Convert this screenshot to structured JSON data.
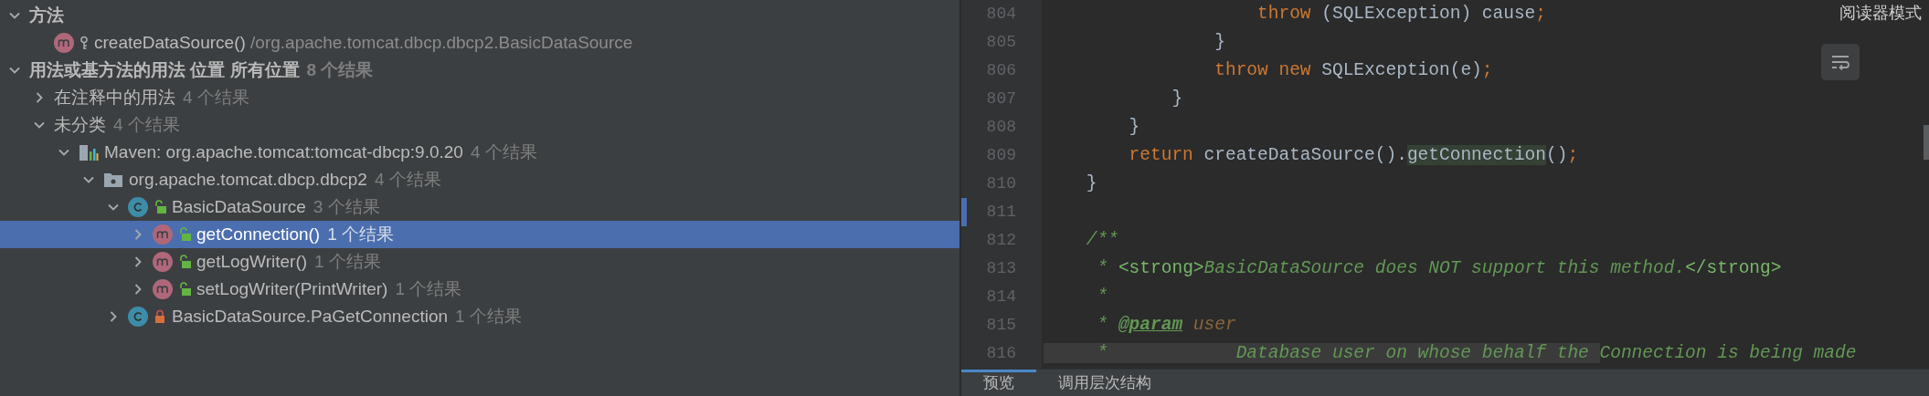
{
  "results_tree": [
    {
      "kind": "group",
      "label": "方法",
      "expanded": true,
      "selected": false,
      "children": [
        {
          "kind": "method",
          "access": {
            "kind": "key"
          },
          "label": "createDataSource()",
          "path": "/org.apache.tomcat.dbcp.dbcp2.BasicDataSource",
          "selected": false
        }
      ]
    },
    {
      "kind": "group",
      "label": "用法或基方法的用法 位置 所有位置",
      "count": "8 个结果",
      "expanded": true,
      "selected": false,
      "children": [
        {
          "kind": "category",
          "label": "在注释中的用法",
          "count": "4 个结果",
          "expanded": false,
          "selected": false
        },
        {
          "kind": "category",
          "label": "未分类",
          "count": "4 个结果",
          "expanded": true,
          "selected": false,
          "children": [
            {
              "kind": "library",
              "label": "Maven: org.apache.tomcat:tomcat-dbcp:9.0.20",
              "count": "4 个结果",
              "expanded": true,
              "selected": false,
              "children": [
                {
                  "kind": "package",
                  "label": "org.apache.tomcat.dbcp.dbcp2",
                  "count": "4 个结果",
                  "expanded": true,
                  "selected": false,
                  "children": [
                    {
                      "kind": "class",
                      "access": {
                        "kind": "public"
                      },
                      "label": "BasicDataSource",
                      "count": "3 个结果",
                      "expanded": true,
                      "selected": false,
                      "children": [
                        {
                          "kind": "method",
                          "access": {
                            "kind": "public"
                          },
                          "label": "getConnection()",
                          "count": "1 个结果",
                          "expanded": false,
                          "selected": true
                        },
                        {
                          "kind": "method",
                          "access": {
                            "kind": "public"
                          },
                          "label": "getLogWriter()",
                          "count": "1 个结果",
                          "expanded": false,
                          "selected": false
                        },
                        {
                          "kind": "method",
                          "access": {
                            "kind": "public"
                          },
                          "label": "setLogWriter(PrintWriter)",
                          "count": "1 个结果",
                          "expanded": false,
                          "selected": false
                        }
                      ]
                    },
                    {
                      "kind": "class",
                      "access": {
                        "kind": "private"
                      },
                      "label": "BasicDataSource.PaGetConnection",
                      "count": "1 个结果",
                      "expanded": false,
                      "selected": false
                    }
                  ]
                }
              ]
            }
          ]
        }
      ]
    }
  ],
  "editor": {
    "reader_mode": "阅读器模式",
    "lines": [
      {
        "number": "804",
        "changed": false,
        "tokens": [
          {
            "t": "                    throw",
            "kind": "kw"
          },
          {
            "t": " (SQLException) cause",
            "kind": "plain"
          },
          {
            "t": ";",
            "kind": "kw"
          }
        ]
      },
      {
        "number": "805",
        "changed": false,
        "tokens": [
          {
            "t": "                }",
            "kind": "plain"
          }
        ]
      },
      {
        "number": "806",
        "changed": false,
        "tokens": [
          {
            "t": "                throw new",
            "kind": "kw"
          },
          {
            "t": " SQLException(e)",
            "kind": "plain"
          },
          {
            "t": ";",
            "kind": "kw"
          }
        ]
      },
      {
        "number": "807",
        "changed": false,
        "tokens": [
          {
            "t": "            }",
            "kind": "plain"
          }
        ]
      },
      {
        "number": "808",
        "changed": false,
        "tokens": [
          {
            "t": "        }",
            "kind": "plain"
          }
        ]
      },
      {
        "number": "809",
        "changed": false,
        "tokens": [
          {
            "t": "        return",
            "kind": "kw"
          },
          {
            "t": " createDataSource().",
            "kind": "plain"
          },
          {
            "t": "getConnection",
            "kind": "plain",
            "usage_highlight": true
          },
          {
            "t": "()",
            "kind": "plain"
          },
          {
            "t": ";",
            "kind": "kw"
          }
        ]
      },
      {
        "number": "810",
        "changed": false,
        "tokens": [
          {
            "t": "    }",
            "kind": "plain"
          }
        ]
      },
      {
        "number": "811",
        "changed": true
      },
      {
        "number": "812",
        "changed": false,
        "tokens": [
          {
            "t": "    /**",
            "kind": "doc"
          }
        ]
      },
      {
        "number": "813",
        "changed": false,
        "tokens": [
          {
            "t": "     * ",
            "kind": "doc"
          },
          {
            "t": "<strong>",
            "kind": "doctag"
          },
          {
            "t": "BasicDataSource does NOT support this method.",
            "kind": "doc"
          },
          {
            "t": "</strong>",
            "kind": "doctag"
          }
        ]
      },
      {
        "number": "814",
        "changed": false,
        "tokens": [
          {
            "t": "     *",
            "kind": "doc"
          }
        ]
      },
      {
        "number": "815",
        "changed": false,
        "tokens": [
          {
            "t": "     * ",
            "kind": "doc"
          },
          {
            "t": "@param",
            "kind": "docparam"
          },
          {
            "t": " user",
            "kind": "paramname"
          }
        ]
      },
      {
        "number": "816",
        "changed": false,
        "tokens": [
          {
            "t": "     *            Database user on whose behalf the ",
            "kind": "doc",
            "shaded": true
          },
          {
            "t": "Connection is being made",
            "kind": "doc"
          }
        ]
      }
    ]
  },
  "bottom_tabs": [
    {
      "label": "预览",
      "selected": true
    },
    {
      "label": "调用层次结构",
      "selected": false
    }
  ]
}
